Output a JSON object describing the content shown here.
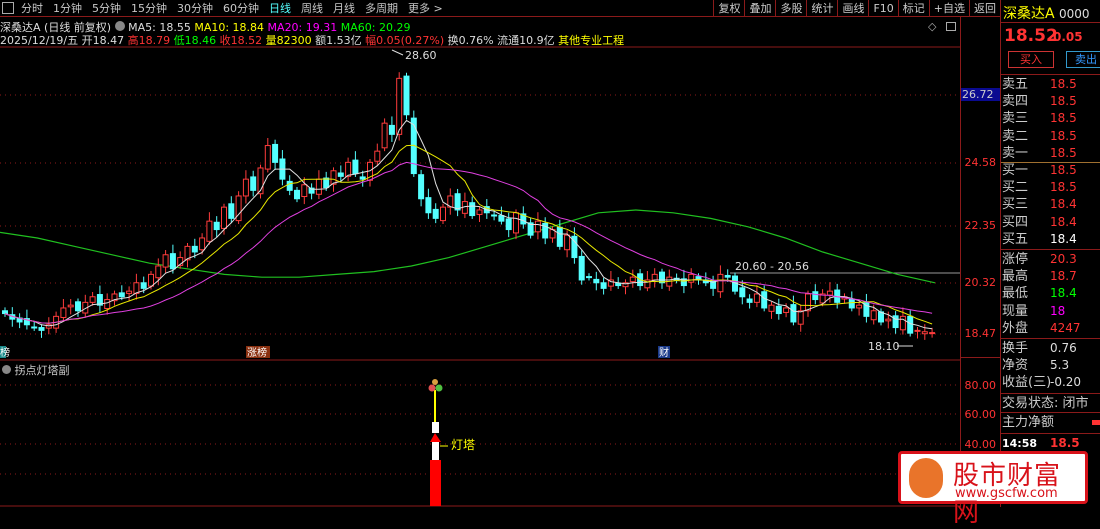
{
  "toolbar": {
    "tabs": [
      "分时",
      "1分钟",
      "5分钟",
      "15分钟",
      "30分钟",
      "60分钟",
      "日线",
      "周线",
      "月线",
      "多周期",
      "更多 >"
    ],
    "active": "日线",
    "tools": [
      "复权",
      "叠加",
      "多股",
      "统计",
      "画线",
      "F10",
      "标记",
      "+自选",
      "返回"
    ]
  },
  "header": {
    "name": "深桑达A (日线 前复权)",
    "ma5": "MA5: 18.55",
    "ma10": "MA10: 18.84",
    "ma20": "MA20: 19.31",
    "ma60": "MA60: 20.29",
    "date": "2025/12/19/五",
    "open": "开18.47",
    "high": "高18.79",
    "low": "低18.46",
    "close": "收18.52",
    "vol": "量82300",
    "amount": "额1.53亿",
    "change": "幅0.05(0.27%)",
    "turnover": "换0.76%",
    "float": "流通10.9亿",
    "industry": "其他专业工程"
  },
  "colors": {
    "up": "#ff3c3c",
    "down": "#54ffff",
    "ma5": "#e0e0e0",
    "ma10": "#e8e800",
    "ma20": "#e040e0",
    "ma60": "#20c020",
    "grid": "#8b1a1a"
  },
  "axis": {
    "price_ticks": [
      "26.72",
      "24.58",
      "22.35",
      "20.32",
      "18.47"
    ],
    "sub_ticks": [
      "80.00",
      "60.00",
      "40.00"
    ]
  },
  "annotations": {
    "max": "28.60",
    "range": "20.60 - 20.56",
    "min": "18.10",
    "markers": [
      "榜",
      "涨榜",
      "财"
    ]
  },
  "candles": {
    "close": [
      19.2,
      19.0,
      18.9,
      18.8,
      18.7,
      18.6,
      18.8,
      19.1,
      19.4,
      19.5,
      19.3,
      19.6,
      19.8,
      19.5,
      19.7,
      19.9,
      19.8,
      20.0,
      20.3,
      20.1,
      20.6,
      20.9,
      21.3,
      20.8,
      21.2,
      21.6,
      21.4,
      21.9,
      22.5,
      22.2,
      23.0,
      22.6,
      23.4,
      24.0,
      23.6,
      24.4,
      25.2,
      24.6,
      24.0,
      23.6,
      23.3,
      23.8,
      23.5,
      24.0,
      23.7,
      24.3,
      24.1,
      24.6,
      24.2,
      24.0,
      24.6,
      25.0,
      26.0,
      25.6,
      27.6,
      26.3,
      24.2,
      23.3,
      22.8,
      22.6,
      23.0,
      23.4,
      22.9,
      23.2,
      22.7,
      22.9,
      22.8,
      22.7,
      22.5,
      22.2,
      22.8,
      22.4,
      22.0,
      22.5,
      21.9,
      22.2,
      21.6,
      22.0,
      21.2,
      20.4,
      20.5,
      20.3,
      20.1,
      20.4,
      20.2,
      20.3,
      20.5,
      20.2,
      20.4,
      20.6,
      20.3,
      20.5,
      20.4,
      20.2,
      20.6,
      20.4,
      20.3,
      20.1,
      20.6,
      20.5,
      20.0,
      19.8,
      19.6,
      19.9,
      19.4,
      19.5,
      19.2,
      19.4,
      18.9,
      19.3,
      19.9,
      19.7,
      19.9,
      20.0,
      19.6,
      19.8,
      19.4,
      19.5,
      19.1,
      19.3,
      18.9,
      19.0,
      18.7,
      19.1,
      18.5,
      18.6,
      18.55,
      18.52
    ],
    "ma60": [
      22.1,
      21.9,
      21.6,
      21.3,
      21.0,
      20.8,
      20.6,
      20.5,
      20.5,
      20.6,
      20.7,
      20.9,
      21.2,
      21.6,
      22.0,
      22.4,
      22.8,
      22.9,
      22.8,
      22.6,
      22.3,
      21.9,
      21.4,
      21.0,
      20.6,
      20.3
    ]
  },
  "sub": {
    "title": "拐点灯塔副",
    "label": "灯塔"
  },
  "quote": {
    "name": "深桑达A",
    "code": "0000",
    "price": "18.52",
    "chg": "0.05",
    "buy": "买入",
    "sell": "卖出",
    "book": [
      {
        "l": "卖五",
        "v": "18.5"
      },
      {
        "l": "卖四",
        "v": "18.5"
      },
      {
        "l": "卖三",
        "v": "18.5"
      },
      {
        "l": "卖二",
        "v": "18.5"
      },
      {
        "l": "卖一",
        "v": "18.5"
      },
      {
        "l": "买一",
        "v": "18.5"
      },
      {
        "l": "买二",
        "v": "18.5"
      },
      {
        "l": "买三",
        "v": "18.4"
      },
      {
        "l": "买四",
        "v": "18.4"
      },
      {
        "l": "买五",
        "v": "18.4"
      }
    ],
    "stats": [
      {
        "l": "涨停",
        "v": "20.3",
        "c": "#f33"
      },
      {
        "l": "最高",
        "v": "18.7",
        "c": "#f33"
      },
      {
        "l": "最低",
        "v": "18.4",
        "c": "#0f0"
      },
      {
        "l": "现量",
        "v": "18",
        "c": "#f0f"
      },
      {
        "l": "外盘",
        "v": "4247",
        "c": "#f33"
      }
    ],
    "fin": [
      {
        "l": "换手",
        "v": "0.76"
      },
      {
        "l": "净资",
        "v": "5.3"
      },
      {
        "l": "收益(三)",
        "v": "-0.20"
      }
    ],
    "status": "交易状态: 闭市",
    "flow": "主力净额",
    "time": "14:58",
    "tick_price": "18.5"
  },
  "watermark": {
    "name": "股市财富网",
    "url": "www.gscfw.com"
  }
}
